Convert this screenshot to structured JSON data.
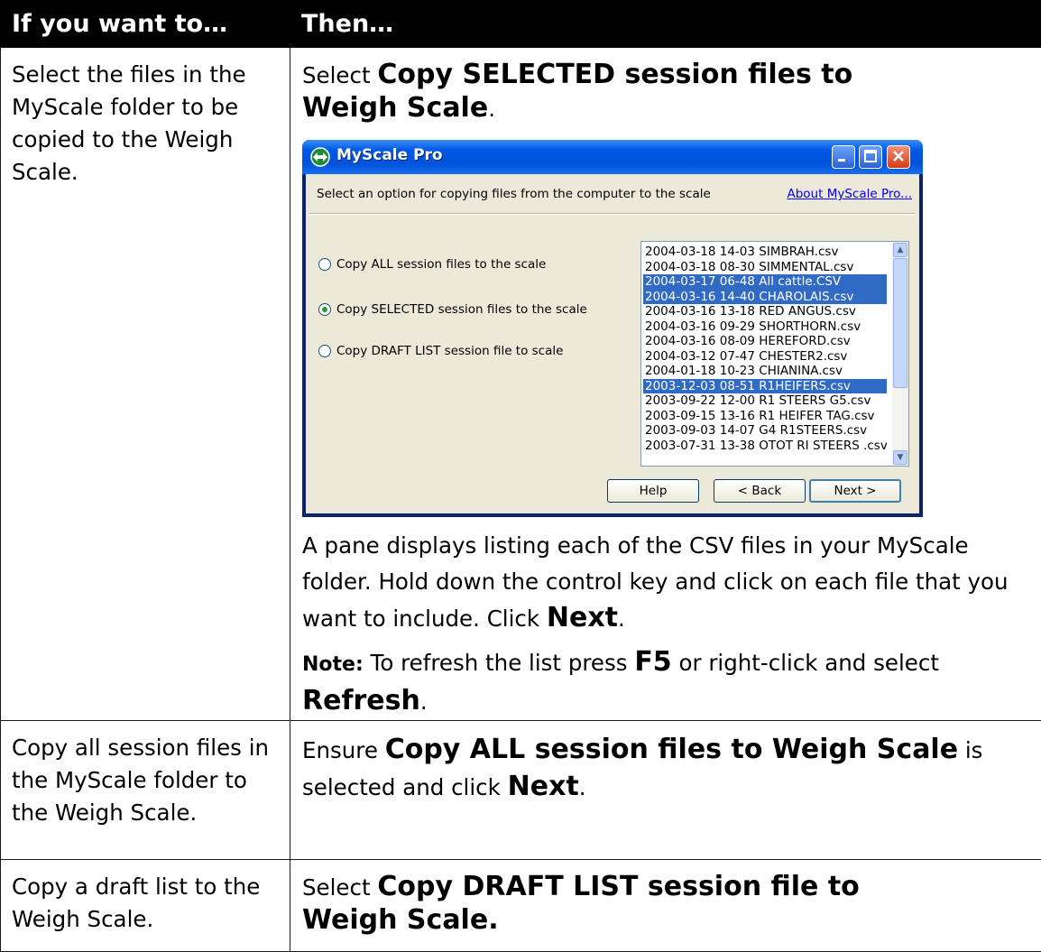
{
  "header": {
    "col1": "If you want to…",
    "col2": "Then…"
  },
  "rows": [
    {
      "condition": "Select the files in the MyScale folder to be copied to the Weigh Scale.",
      "step_pre": "Select ",
      "step_bold": "Copy SELECTED session files to Weigh Scale",
      "step_post": ".",
      "para1_text": "A pane displays listing each of the CSV files in your MyScale folder. Hold down the control key and click on each file that you want to include. Click ",
      "para1_bold": "Next",
      "para1_post": ".",
      "note_label": "Note:",
      "note_text": " To refresh the list press ",
      "note_key": "F5",
      "note_mid": " or right-click and select ",
      "note_bold": "Refresh",
      "note_post": "."
    },
    {
      "condition": "Copy all session files in the MyScale folder to the Weigh Scale.",
      "step_pre": "Ensure ",
      "step_bold": "Copy ALL session files to Weigh Scale",
      "step_mid": " is selected and click ",
      "step_bold2": "Next",
      "step_post": "."
    },
    {
      "condition": "Copy a draft list to the Weigh Scale.",
      "step_pre": "Select ",
      "step_bold": "Copy DRAFT LIST session file to Weigh Scale."
    }
  ],
  "app": {
    "title": "MyScale Pro",
    "instruction": "Select an option for copying files from the computer to the scale",
    "about_link": "About MyScale Pro...",
    "options": [
      {
        "label": "Copy ALL session files to the scale",
        "checked": false
      },
      {
        "label": "Copy SELECTED session files to the scale",
        "checked": true
      },
      {
        "label": "Copy DRAFT LIST session file to scale",
        "checked": false
      }
    ],
    "files": [
      {
        "name": "2004-03-18 14-03 SIMBRAH.csv",
        "selected": false
      },
      {
        "name": "2004-03-18 08-30 SIMMENTAL.csv",
        "selected": false
      },
      {
        "name": "2004-03-17 06-48 All cattle.CSV",
        "selected": true
      },
      {
        "name": "2004-03-16 14-40 CHAROLAIS.csv",
        "selected": true
      },
      {
        "name": "2004-03-16 13-18 RED ANGUS.csv",
        "selected": false
      },
      {
        "name": "2004-03-16 09-29 SHORTHORN.csv",
        "selected": false
      },
      {
        "name": "2004-03-16 08-09 HEREFORD.csv",
        "selected": false
      },
      {
        "name": "2004-03-12 07-47 CHESTER2.csv",
        "selected": false
      },
      {
        "name": "2004-01-18 10-23 CHIANINA.csv",
        "selected": false
      },
      {
        "name": "2003-12-03 08-51 R1HEIFERS.csv",
        "selected": true
      },
      {
        "name": "2003-09-22 12-00 R1 STEERS G5.csv",
        "selected": false
      },
      {
        "name": "2003-09-15 13-16 R1 HEIFER TAG.csv",
        "selected": false
      },
      {
        "name": "2003-09-03 14-07 G4 R1STEERS.csv",
        "selected": false
      },
      {
        "name": "2003-07-31 13-38 OTOT RI STEERS .csv",
        "selected": false
      }
    ],
    "buttons": {
      "help": "Help",
      "back": "< Back",
      "next": "Next >"
    },
    "colors": {
      "titlebar": "#0058e6",
      "selection": "#316ac5",
      "dialog_bg": "#ece9d8"
    }
  }
}
